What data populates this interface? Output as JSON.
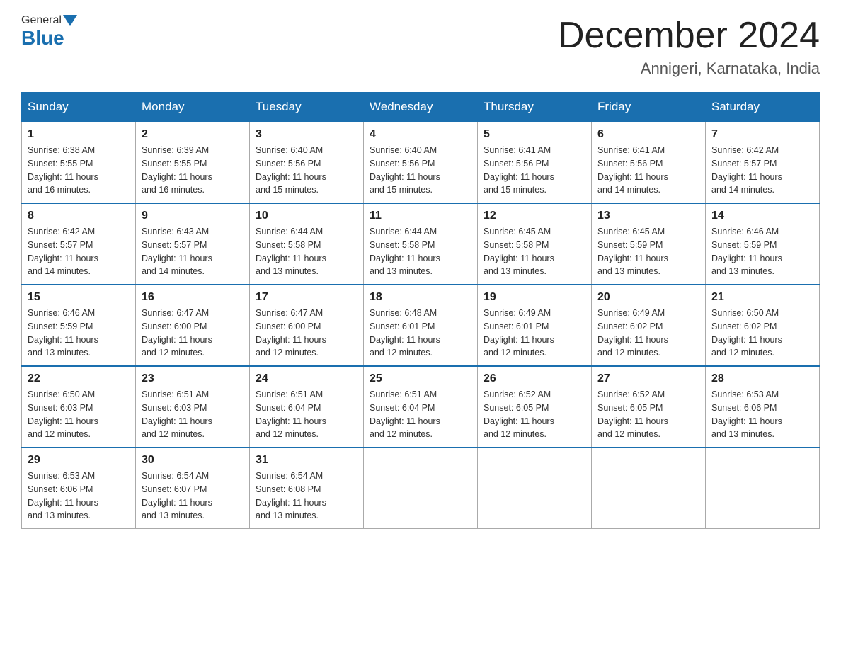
{
  "header": {
    "logo_general": "General",
    "logo_blue": "Blue",
    "month_title": "December 2024",
    "location": "Annigeri, Karnataka, India"
  },
  "days_of_week": [
    "Sunday",
    "Monday",
    "Tuesday",
    "Wednesday",
    "Thursday",
    "Friday",
    "Saturday"
  ],
  "weeks": [
    [
      {
        "day": "1",
        "sunrise": "6:38 AM",
        "sunset": "5:55 PM",
        "daylight": "11 hours and 16 minutes."
      },
      {
        "day": "2",
        "sunrise": "6:39 AM",
        "sunset": "5:55 PM",
        "daylight": "11 hours and 16 minutes."
      },
      {
        "day": "3",
        "sunrise": "6:40 AM",
        "sunset": "5:56 PM",
        "daylight": "11 hours and 15 minutes."
      },
      {
        "day": "4",
        "sunrise": "6:40 AM",
        "sunset": "5:56 PM",
        "daylight": "11 hours and 15 minutes."
      },
      {
        "day": "5",
        "sunrise": "6:41 AM",
        "sunset": "5:56 PM",
        "daylight": "11 hours and 15 minutes."
      },
      {
        "day": "6",
        "sunrise": "6:41 AM",
        "sunset": "5:56 PM",
        "daylight": "11 hours and 14 minutes."
      },
      {
        "day": "7",
        "sunrise": "6:42 AM",
        "sunset": "5:57 PM",
        "daylight": "11 hours and 14 minutes."
      }
    ],
    [
      {
        "day": "8",
        "sunrise": "6:42 AM",
        "sunset": "5:57 PM",
        "daylight": "11 hours and 14 minutes."
      },
      {
        "day": "9",
        "sunrise": "6:43 AM",
        "sunset": "5:57 PM",
        "daylight": "11 hours and 14 minutes."
      },
      {
        "day": "10",
        "sunrise": "6:44 AM",
        "sunset": "5:58 PM",
        "daylight": "11 hours and 13 minutes."
      },
      {
        "day": "11",
        "sunrise": "6:44 AM",
        "sunset": "5:58 PM",
        "daylight": "11 hours and 13 minutes."
      },
      {
        "day": "12",
        "sunrise": "6:45 AM",
        "sunset": "5:58 PM",
        "daylight": "11 hours and 13 minutes."
      },
      {
        "day": "13",
        "sunrise": "6:45 AM",
        "sunset": "5:59 PM",
        "daylight": "11 hours and 13 minutes."
      },
      {
        "day": "14",
        "sunrise": "6:46 AM",
        "sunset": "5:59 PM",
        "daylight": "11 hours and 13 minutes."
      }
    ],
    [
      {
        "day": "15",
        "sunrise": "6:46 AM",
        "sunset": "5:59 PM",
        "daylight": "11 hours and 13 minutes."
      },
      {
        "day": "16",
        "sunrise": "6:47 AM",
        "sunset": "6:00 PM",
        "daylight": "11 hours and 12 minutes."
      },
      {
        "day": "17",
        "sunrise": "6:47 AM",
        "sunset": "6:00 PM",
        "daylight": "11 hours and 12 minutes."
      },
      {
        "day": "18",
        "sunrise": "6:48 AM",
        "sunset": "6:01 PM",
        "daylight": "11 hours and 12 minutes."
      },
      {
        "day": "19",
        "sunrise": "6:49 AM",
        "sunset": "6:01 PM",
        "daylight": "11 hours and 12 minutes."
      },
      {
        "day": "20",
        "sunrise": "6:49 AM",
        "sunset": "6:02 PM",
        "daylight": "11 hours and 12 minutes."
      },
      {
        "day": "21",
        "sunrise": "6:50 AM",
        "sunset": "6:02 PM",
        "daylight": "11 hours and 12 minutes."
      }
    ],
    [
      {
        "day": "22",
        "sunrise": "6:50 AM",
        "sunset": "6:03 PM",
        "daylight": "11 hours and 12 minutes."
      },
      {
        "day": "23",
        "sunrise": "6:51 AM",
        "sunset": "6:03 PM",
        "daylight": "11 hours and 12 minutes."
      },
      {
        "day": "24",
        "sunrise": "6:51 AM",
        "sunset": "6:04 PM",
        "daylight": "11 hours and 12 minutes."
      },
      {
        "day": "25",
        "sunrise": "6:51 AM",
        "sunset": "6:04 PM",
        "daylight": "11 hours and 12 minutes."
      },
      {
        "day": "26",
        "sunrise": "6:52 AM",
        "sunset": "6:05 PM",
        "daylight": "11 hours and 12 minutes."
      },
      {
        "day": "27",
        "sunrise": "6:52 AM",
        "sunset": "6:05 PM",
        "daylight": "11 hours and 12 minutes."
      },
      {
        "day": "28",
        "sunrise": "6:53 AM",
        "sunset": "6:06 PM",
        "daylight": "11 hours and 13 minutes."
      }
    ],
    [
      {
        "day": "29",
        "sunrise": "6:53 AM",
        "sunset": "6:06 PM",
        "daylight": "11 hours and 13 minutes."
      },
      {
        "day": "30",
        "sunrise": "6:54 AM",
        "sunset": "6:07 PM",
        "daylight": "11 hours and 13 minutes."
      },
      {
        "day": "31",
        "sunrise": "6:54 AM",
        "sunset": "6:08 PM",
        "daylight": "11 hours and 13 minutes."
      },
      null,
      null,
      null,
      null
    ]
  ],
  "labels": {
    "sunrise": "Sunrise: ",
    "sunset": "Sunset: ",
    "daylight": "Daylight: "
  }
}
